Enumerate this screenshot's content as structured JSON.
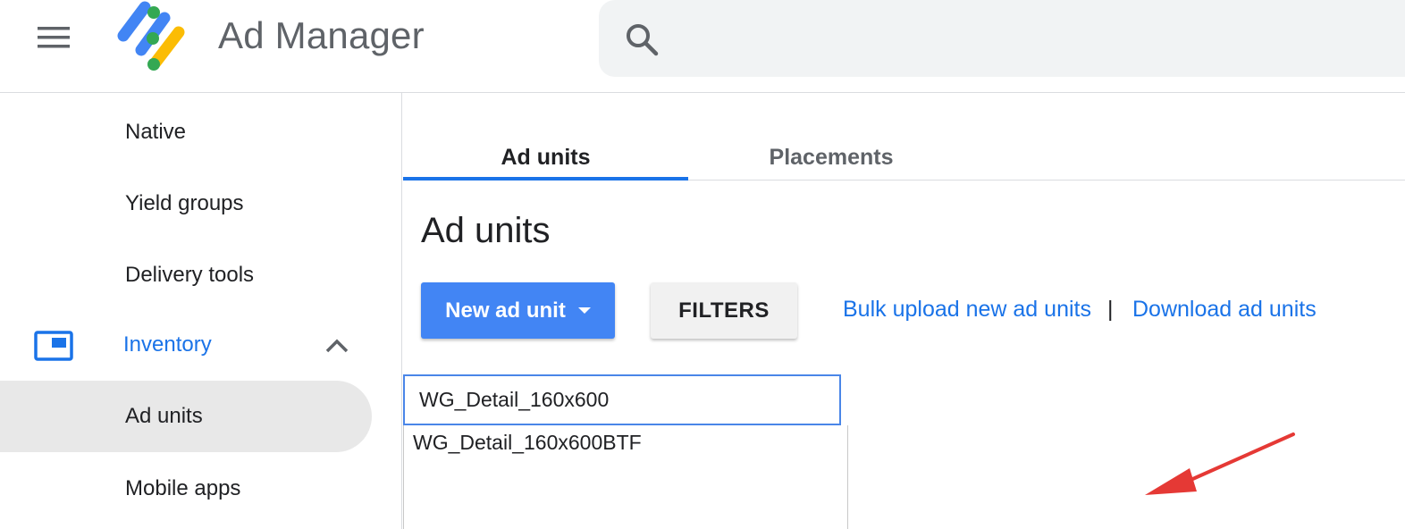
{
  "header": {
    "app_title": "Ad Manager",
    "search_placeholder": "",
    "icons": {
      "menu": "hamburger-menu-icon",
      "logo": "ad-manager-logo",
      "search": "search-icon"
    }
  },
  "sidebar": {
    "items": [
      {
        "label": "Native",
        "active": false
      },
      {
        "label": "Yield groups",
        "active": false
      },
      {
        "label": "Delivery tools",
        "active": false
      },
      {
        "label": "Inventory",
        "active": false,
        "expanded": true,
        "icon": "inventory-icon"
      },
      {
        "label": "Ad units",
        "active": true
      },
      {
        "label": "Mobile apps",
        "active": false
      }
    ]
  },
  "tabs": [
    {
      "label": "Ad units",
      "selected": true
    },
    {
      "label": "Placements",
      "selected": false
    }
  ],
  "main": {
    "title": "Ad units",
    "new_button_label": "New ad unit",
    "filters_label": "FILTERS",
    "bulk_upload_link": "Bulk upload new ad units",
    "separator": "|",
    "download_link": "Download ad units",
    "search_value": "WG_Detail_160x600",
    "suggestions": [
      "WG_Detail_160x600BTF"
    ]
  },
  "colors": {
    "accent": "#1a73e8",
    "primary_button": "#4285f4",
    "annotation_arrow": "#e53935"
  }
}
